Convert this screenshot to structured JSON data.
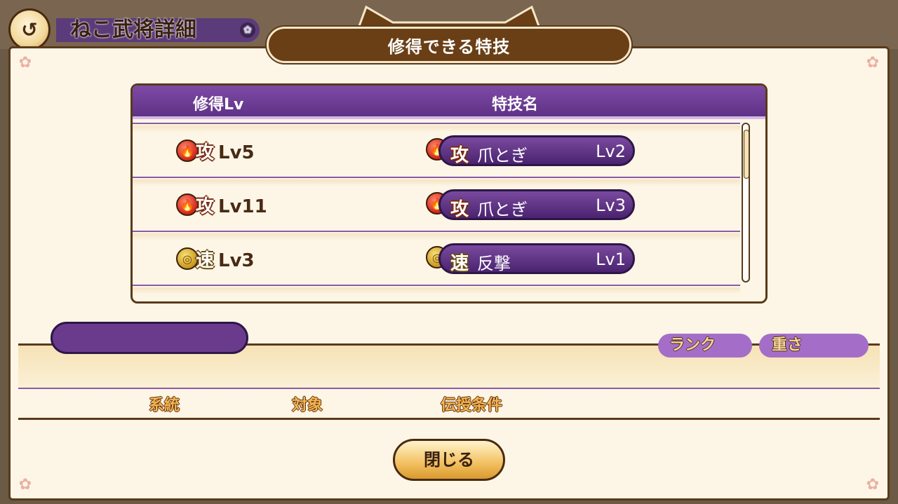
{
  "background": {
    "screen_title": "ねこ武将詳細",
    "back_icon": "back-arrow-icon"
  },
  "modal": {
    "title": "修得できる特技",
    "table": {
      "col_level": "修得Lv",
      "col_skill": "特技名",
      "rows": [
        {
          "req_type": "攻",
          "req_level": "Lv5",
          "skill_type": "攻",
          "skill_name": "爪とぎ",
          "skill_level": "Lv2"
        },
        {
          "req_type": "攻",
          "req_level": "Lv11",
          "skill_type": "攻",
          "skill_name": "爪とぎ",
          "skill_level": "Lv3"
        },
        {
          "req_type": "速",
          "req_level": "Lv3",
          "skill_type": "速",
          "skill_name": "反撃",
          "skill_level": "Lv1"
        }
      ]
    },
    "detail": {
      "rank_label": "ランク",
      "weight_label": "重さ",
      "lineage_label": "系統",
      "target_label": "対象",
      "transfer_condition_label": "伝授条件"
    },
    "close_label": "閉じる"
  }
}
